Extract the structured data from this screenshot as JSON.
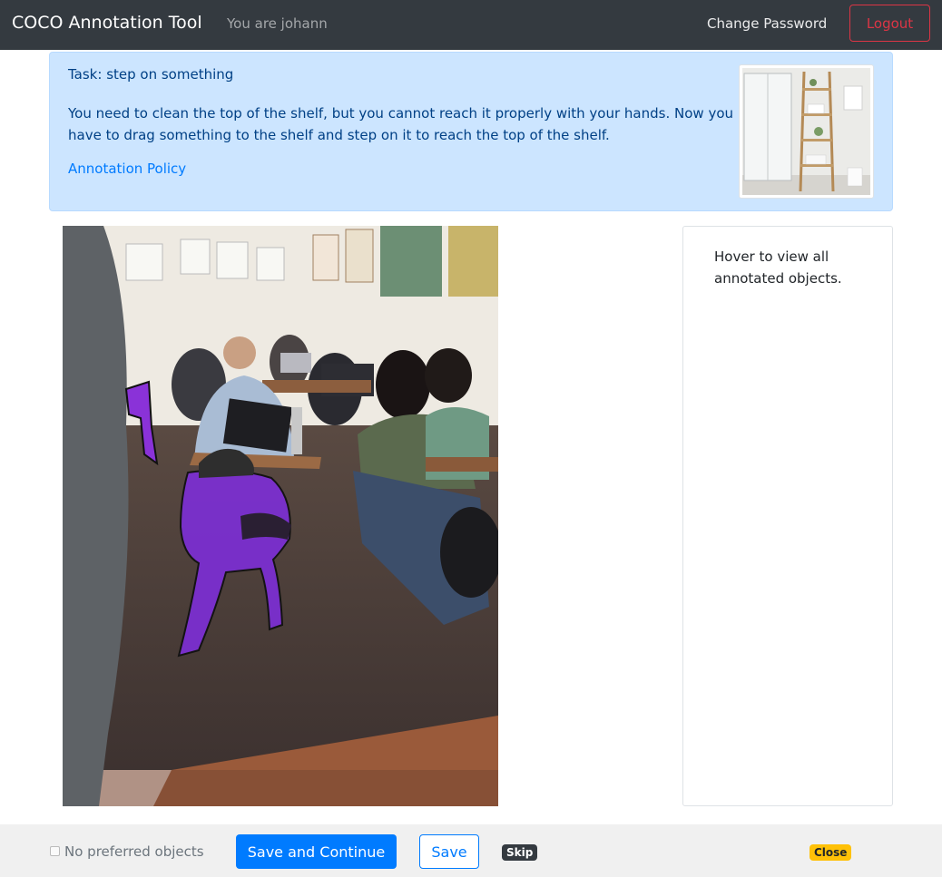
{
  "navbar": {
    "brand": "COCO Annotation Tool",
    "user_text": "You are johann",
    "change_password": "Change Password",
    "logout": "Logout"
  },
  "task": {
    "title": "Task: step on something",
    "description": "You need to clean the top of the shelf, but you cannot reach it properly with your hands. Now you have to drag something to the shelf and step on it to reach the top of the shelf.",
    "policy_link": "Annotation Policy"
  },
  "objects_panel": {
    "hint": "Hover to view all annotated objects."
  },
  "footer": {
    "no_preferred_label": "No preferred objects",
    "no_preferred_checked": false,
    "save_continue": "Save and Continue",
    "save": "Save",
    "skip": "Skip",
    "close": "Close"
  },
  "colors": {
    "navbar": "#343a40",
    "alert_bg": "#cce5ff",
    "primary": "#007bff",
    "danger": "#dc3545",
    "warning": "#ffc107",
    "annotation": "#7b2fd0"
  }
}
